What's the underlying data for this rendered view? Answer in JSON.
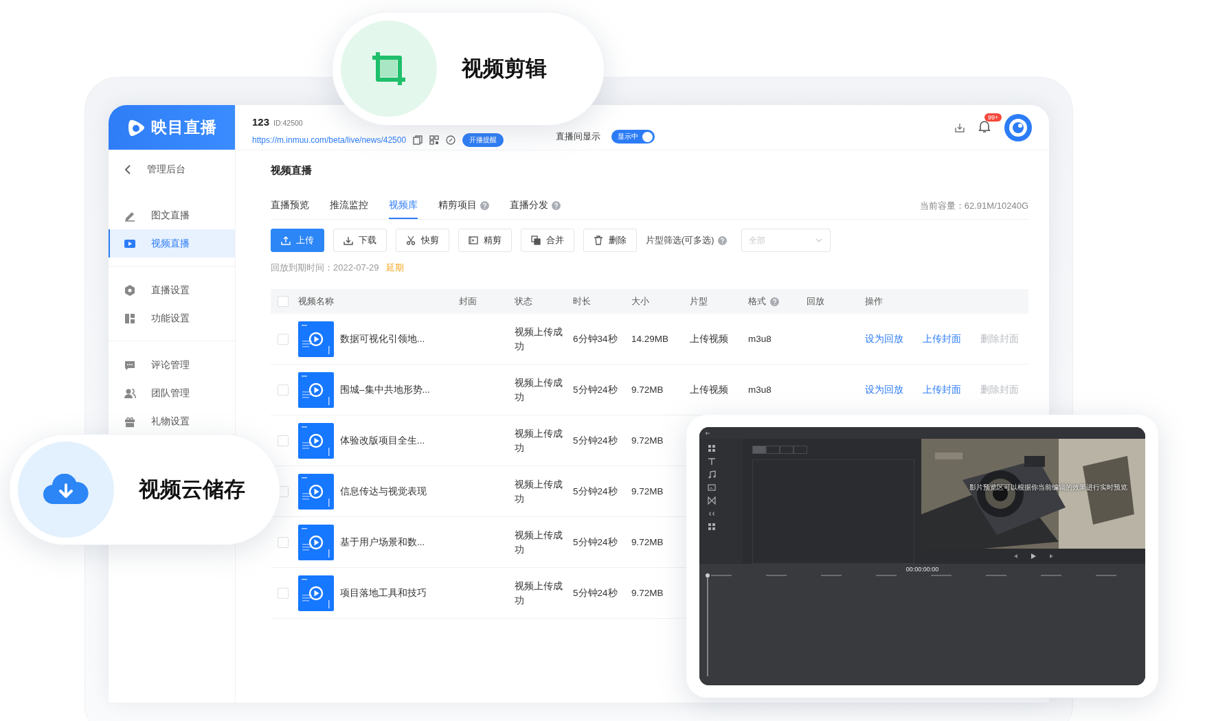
{
  "callouts": [
    {
      "kind": "crop",
      "label": "视频剪辑"
    },
    {
      "kind": "cloud",
      "label": "视频云储存"
    }
  ],
  "app": {
    "logo": "映目直播",
    "sidebar": {
      "back": "管理后台",
      "groups": [
        [
          {
            "label": "图文直播",
            "selected": false
          },
          {
            "label": "视频直播",
            "selected": true
          }
        ],
        [
          {
            "label": "直播设置",
            "selected": false
          },
          {
            "label": "功能设置",
            "selected": false
          }
        ],
        [
          {
            "label": "评论管理",
            "selected": false
          },
          {
            "label": "团队管理",
            "selected": false
          },
          {
            "label": "礼物设置",
            "selected": false
          }
        ]
      ]
    },
    "topbar": {
      "name": "123",
      "id": "ID:42500",
      "url": "https://m.inmuu.com/beta/live/news/42500",
      "remind_button": "开播提醒",
      "display_label": "直播间显示",
      "display_toggle": {
        "label": "显示中",
        "on": true
      },
      "notification_badge": "99+"
    },
    "title": "视频直播",
    "tabs": [
      {
        "label": "直播预览",
        "selected": false,
        "help": false
      },
      {
        "label": "推流监控",
        "selected": false,
        "help": false
      },
      {
        "label": "视频库",
        "selected": true,
        "help": false
      },
      {
        "label": "精剪项目",
        "selected": false,
        "help": true
      },
      {
        "label": "直播分发",
        "selected": false,
        "help": true
      }
    ],
    "capacity": "当前容量：62.91M/10240G",
    "toolbar": {
      "buttons": [
        {
          "kind": "upload",
          "label": "上传",
          "primary": true
        },
        {
          "kind": "download",
          "label": "下载",
          "primary": false
        },
        {
          "kind": "cut",
          "label": "快剪",
          "primary": false
        },
        {
          "kind": "edit",
          "label": "精剪",
          "primary": false
        },
        {
          "kind": "merge",
          "label": "合并",
          "primary": false
        },
        {
          "kind": "delete",
          "label": "删除",
          "primary": false
        }
      ],
      "filter_label": "片型筛选(可多选)",
      "filter_select": {
        "placeholder": "全部"
      }
    },
    "expiry": {
      "label": "回放到期时间：2022-07-29",
      "link": "延期"
    },
    "table": {
      "header_checked": false,
      "columns": [
        {
          "label": "视频名称",
          "help": false
        },
        {
          "label": "封面",
          "help": false
        },
        {
          "label": "状态",
          "help": false
        },
        {
          "label": "时长",
          "help": false
        },
        {
          "label": "大小",
          "help": false
        },
        {
          "label": "片型",
          "help": false
        },
        {
          "label": "格式",
          "help": true
        },
        {
          "label": "回放",
          "help": false
        },
        {
          "label": "操作",
          "help": false
        }
      ],
      "rows": [
        {
          "checked": false,
          "name": "数据可视化引领地...",
          "status": "视频上传成功",
          "duration": "6分钟34秒",
          "size": "14.29MB",
          "type": "上传视频",
          "format": "m3u8",
          "actions": [
            {
              "label": "设为回放",
              "disabled": false
            },
            {
              "label": "上传封面",
              "disabled": false
            },
            {
              "label": "删除封面",
              "disabled": true
            }
          ]
        },
        {
          "checked": false,
          "name": "围城–集中共地形势...",
          "status": "视频上传成功",
          "duration": "5分钟24秒",
          "size": "9.72MB",
          "type": "上传视频",
          "format": "m3u8",
          "actions": [
            {
              "label": "设为回放",
              "disabled": false
            },
            {
              "label": "上传封面",
              "disabled": false
            },
            {
              "label": "删除封面",
              "disabled": true
            }
          ]
        },
        {
          "checked": false,
          "name": "体验改版项目全生...",
          "status": "视频上传成功",
          "duration": "5分钟24秒",
          "size": "9.72MB"
        },
        {
          "checked": false,
          "name": "信息传达与视觉表现",
          "status": "视频上传成功",
          "duration": "5分钟24秒",
          "size": "9.72MB"
        },
        {
          "checked": false,
          "name": "基于用户场景和数...",
          "status": "视频上传成功",
          "duration": "5分钟24秒",
          "size": "9.72MB"
        },
        {
          "checked": false,
          "name": "项目落地工具和技巧",
          "status": "视频上传成功",
          "duration": "5分钟24秒",
          "size": "9.72MB"
        }
      ]
    }
  },
  "editor": {
    "preview_caption": "影片预览区可以根据你当前编辑的效果进行实时预览",
    "timecode": "00:00:00:00"
  }
}
